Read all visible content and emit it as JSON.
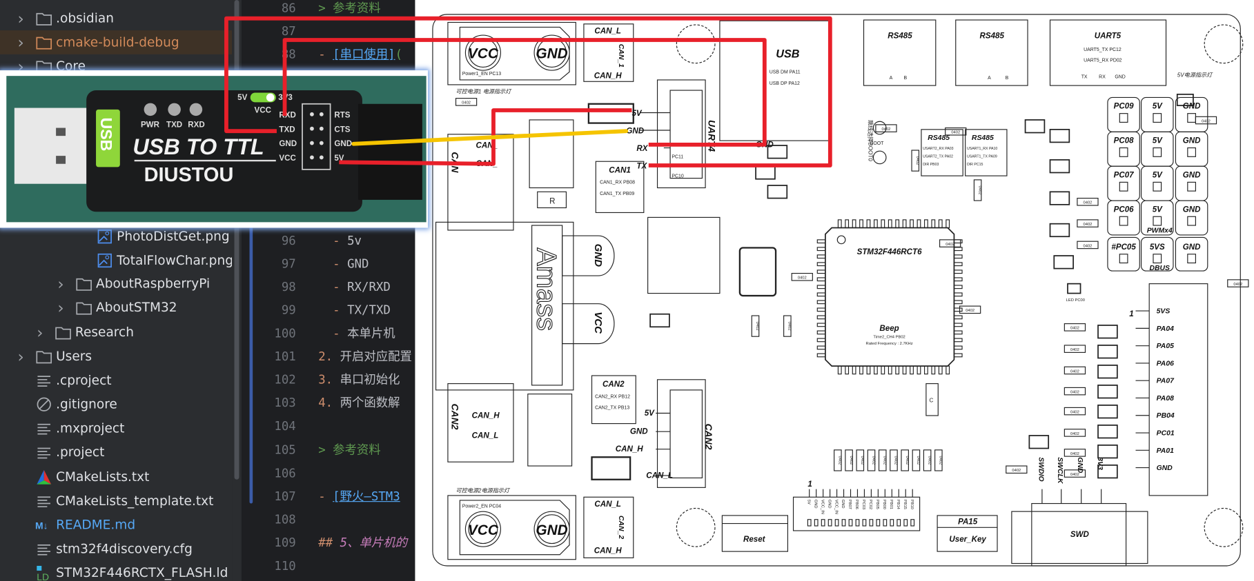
{
  "sidebar": {
    "items": [
      {
        "label": ".obsidian",
        "icon": "folder-icon",
        "chevron": true,
        "indent": 0
      },
      {
        "label": "cmake-build-debug",
        "icon": "folder-icon",
        "chevron": true,
        "indent": 0,
        "selected": true
      },
      {
        "label": "Core",
        "icon": "folder-icon",
        "chevron": true,
        "indent": 0
      },
      {
        "label": "PhotoDistGet.png",
        "icon": "image-icon",
        "chevron": false,
        "indent": 3
      },
      {
        "label": "TotalFlowChar.png",
        "icon": "image-icon",
        "chevron": false,
        "indent": 3
      },
      {
        "label": "AboutRaspberryPi",
        "icon": "folder-icon",
        "chevron": true,
        "indent": 2
      },
      {
        "label": "AboutSTM32",
        "icon": "folder-icon",
        "chevron": true,
        "indent": 2
      },
      {
        "label": "Research",
        "icon": "folder-icon",
        "chevron": true,
        "indent": 1
      },
      {
        "label": "Users",
        "icon": "folder-icon",
        "chevron": true,
        "indent": 0
      },
      {
        "label": ".cproject",
        "icon": "text-file-icon",
        "chevron": false,
        "indent": 0
      },
      {
        "label": ".gitignore",
        "icon": "ignore-file-icon",
        "chevron": false,
        "indent": 0
      },
      {
        "label": ".mxproject",
        "icon": "text-file-icon",
        "chevron": false,
        "indent": 0
      },
      {
        "label": ".project",
        "icon": "text-file-icon",
        "chevron": false,
        "indent": 0
      },
      {
        "label": "CMakeLists.txt",
        "icon": "cmake-icon",
        "chevron": false,
        "indent": 0
      },
      {
        "label": "CMakeLists_template.txt",
        "icon": "text-file-icon",
        "chevron": false,
        "indent": 0
      },
      {
        "label": "README.md",
        "icon": "markdown-icon",
        "chevron": false,
        "indent": 0,
        "markdown": true
      },
      {
        "label": "stm32f4discovery.cfg",
        "icon": "text-file-icon",
        "chevron": false,
        "indent": 0
      },
      {
        "label": "STM32F446RCTX_FLASH.ld",
        "icon": "linker-file-icon",
        "chevron": false,
        "indent": 0
      }
    ],
    "markdown_icon_text": "M↓",
    "linker_icon_text": "LD"
  },
  "editor": {
    "lines": [
      {
        "num": "86",
        "segs": [
          {
            "t": "> ",
            "s": "s-quote"
          },
          {
            "t": "参考资料",
            "s": "s-quote"
          }
        ]
      },
      {
        "num": "87",
        "segs": []
      },
      {
        "num": "88",
        "segs": [
          {
            "t": "- ",
            "s": "s-dash"
          },
          {
            "t": "[串口使用]",
            "s": "s-link"
          },
          {
            "t": "(",
            "s": "s-quote"
          }
        ]
      },
      {
        "num": "96",
        "segs": [
          {
            "t": "  - ",
            "s": "s-dash"
          },
          {
            "t": "5v",
            "s": ""
          }
        ]
      },
      {
        "num": "97",
        "segs": [
          {
            "t": "  - ",
            "s": "s-dash"
          },
          {
            "t": "GND",
            "s": ""
          }
        ]
      },
      {
        "num": "98",
        "segs": [
          {
            "t": "  - ",
            "s": "s-dash"
          },
          {
            "t": "RX/RXD",
            "s": ""
          }
        ]
      },
      {
        "num": "99",
        "segs": [
          {
            "t": "  - ",
            "s": "s-dash"
          },
          {
            "t": "TX/TXD",
            "s": ""
          }
        ]
      },
      {
        "num": "100",
        "segs": [
          {
            "t": "  - ",
            "s": "s-dash"
          },
          {
            "t": "本单片机",
            "s": ""
          }
        ]
      },
      {
        "num": "101",
        "segs": [
          {
            "t": "2. ",
            "s": "s-num"
          },
          {
            "t": "开启对应配置",
            "s": ""
          }
        ]
      },
      {
        "num": "102",
        "segs": [
          {
            "t": "3. ",
            "s": "s-num"
          },
          {
            "t": "串口初始化",
            "s": ""
          }
        ]
      },
      {
        "num": "103",
        "segs": [
          {
            "t": "4. ",
            "s": "s-num"
          },
          {
            "t": "两个函数解",
            "s": ""
          }
        ]
      },
      {
        "num": "104",
        "segs": []
      },
      {
        "num": "105",
        "segs": [
          {
            "t": "> ",
            "s": "s-quote"
          },
          {
            "t": "参考资料",
            "s": "s-quote"
          }
        ]
      },
      {
        "num": "106",
        "segs": []
      },
      {
        "num": "107",
        "segs": [
          {
            "t": "- ",
            "s": "s-dash"
          },
          {
            "t": "[野火—STM3",
            "s": "s-link"
          }
        ]
      },
      {
        "num": "108",
        "segs": []
      },
      {
        "num": "109",
        "segs": [
          {
            "t": "## ",
            "s": "s-head"
          },
          {
            "t": "5、单片机的",
            "s": "s-headtxt"
          }
        ]
      },
      {
        "num": "110",
        "segs": []
      }
    ]
  },
  "photo": {
    "usb_tab": "USB",
    "leds": [
      "PWR",
      "TXD",
      "RXD"
    ],
    "switch_left": "5V",
    "switch_right": "3V3",
    "switch_label": "VCC",
    "title": "USB TO TTL",
    "brand": "DIUSTOU",
    "pins_left": [
      "RXD",
      "TXD",
      "GND",
      "VCC"
    ],
    "pins_right": [
      "RTS",
      "CTS",
      "GND",
      "5V"
    ]
  },
  "wires": {
    "red": "#e8202a",
    "yellow": "#f5c400"
  },
  "board": {
    "power1": {
      "vcc": "VCC",
      "gnd": "GND",
      "en": "Power1_EN   PC13",
      "indicator": "可控电源1 电源指示灯"
    },
    "can1_terminal": {
      "l": "CAN_L",
      "name": "CAN_1",
      "h": "CAN_H"
    },
    "can_left": {
      "name": "CAN",
      "h": "CAN_",
      "l": "CAN_"
    },
    "uart4": {
      "name": "UART4",
      "v5": "5V",
      "gnd": "GND",
      "rx": "RX",
      "tx": "TX",
      "pc11": "PC11",
      "pc10": "PC10"
    },
    "can1": {
      "title": "CAN1",
      "rx": "CAN1_RX    PB08",
      "tx": "CAN1_TX    PB09"
    },
    "usb": {
      "title": "USB",
      "dm": "USB DM   PA11",
      "dp": "USB DP   PA12",
      "gnd": "GND"
    },
    "rs485_a": {
      "title": "RS485",
      "a": "A",
      "b": "B"
    },
    "rs485_b": {
      "title": "RS485",
      "a": "A",
      "b": "B"
    },
    "uart5": {
      "title": "UART5",
      "tx": "UART5_TX    PC12",
      "rx": "UART5_RX    PD02",
      "p1": "TX",
      "p2": "RX",
      "p3": "GND"
    },
    "led5v": "5V电源指示灯",
    "boot": {
      "jumper": "跳线选择BOOT0",
      "label": "BOOT"
    },
    "rs485_mod1": {
      "title": "RS485",
      "r1": "USART2_RX   PA03",
      "r2": "USART2_TX   PA02",
      "r3": "DIR            PB03"
    },
    "rs485_mod2": {
      "title": "RS485",
      "r1": "USART1_RX   PA10",
      "r2": "USART1_TX   PA09",
      "r3": "DIR            PC15"
    },
    "pwm": {
      "grid": [
        [
          "PC09",
          "5V",
          "GND"
        ],
        [
          "PC08",
          "5V",
          "GND"
        ],
        [
          "PC07",
          "5V",
          "GND"
        ],
        [
          "PC06",
          "5V",
          "GND"
        ]
      ],
      "label": "PWMx4"
    },
    "dbus": {
      "row": [
        "#PC05",
        "5VS",
        "GND"
      ],
      "label": "DBUS"
    },
    "mcu": "STM32F446RCT6",
    "beep": {
      "title": "Beep",
      "pin": "Time2_CH4    PB02",
      "freq": "Rated Frequency : 2.7KHz"
    },
    "amass": {
      "brand": "Amass",
      "gnd": "GND",
      "vcc": "VCC"
    },
    "can2_left": {
      "name": "CAN2",
      "h": "CAN_H",
      "l": "CAN_L"
    },
    "can2": {
      "title": "CAN2",
      "rx": "CAN2_RX    PB12",
      "tx": "CAN2_TX    PB13"
    },
    "can2_conn": {
      "name": "CAN2",
      "pins": [
        "5V",
        "GND",
        "CAN_H",
        "CAN_L"
      ]
    },
    "power2": {
      "vcc": "VCC",
      "gnd": "GND",
      "en": "Power2_EN   PC04",
      "indicator": "可控电源2电源指示灯"
    },
    "can2_terminal": {
      "l": "CAN_L",
      "name": "CAN_2",
      "h": "CAN_H"
    },
    "reset": "Reset",
    "user_key": {
      "pin": "PA15",
      "name": "User_Key"
    },
    "header": {
      "pin1": "1",
      "pins": [
        "5V",
        "GND",
        "VCC_IN",
        "GND",
        "VCC_IN",
        "GND",
        "PB07",
        "PB06",
        "PC03",
        "PC02",
        "PB05",
        "PB00",
        "PB01",
        "PB14",
        "PB15",
        "PB10"
      ]
    },
    "swd": {
      "title": "SWD",
      "pins": [
        "SWDIO",
        "SWCLK",
        "GND",
        "3V3"
      ]
    },
    "right_header": {
      "pin1": "1",
      "pins": [
        "5VS",
        "PA04",
        "PA05",
        "PA06",
        "PA07",
        "PA08",
        "PB04",
        "PC01",
        "PA01",
        "GND"
      ]
    },
    "led_pc00": "LED   PC00",
    "resistor_label": "0402",
    "rp_label": "R",
    "cap_label": "C"
  }
}
